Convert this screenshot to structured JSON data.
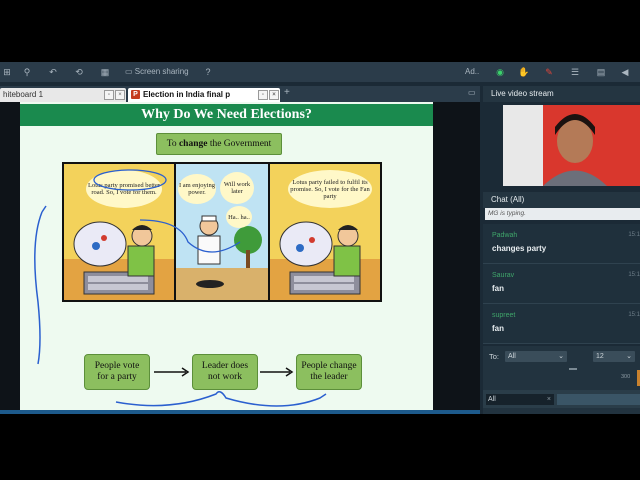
{
  "toolbar": {
    "screen_sharing_label": "Screen sharing",
    "user_initials": "Ad.."
  },
  "tabs": [
    {
      "label": "hiteboard 1"
    },
    {
      "label": "Election in India final p"
    }
  ],
  "slide": {
    "title": "Why Do We Need Elections?",
    "purpose_prefix": "To",
    "purpose_bold": "change",
    "purpose_suffix": "the Government",
    "panel1_bubble": "Lotus party promised better road. So, I vote for them.",
    "panel2_bubble1": "I am enjoying power.",
    "panel2_bubble2": "Will work later",
    "panel2_bubble3": "Ha.. ha..",
    "panel3_bubble": "Lotus party failed to fulfil its promise. So, I vote for the Fan party",
    "flow": [
      {
        "label": "People vote for a party"
      },
      {
        "label": "Leader does not work"
      },
      {
        "label": "People change the leader"
      }
    ]
  },
  "video": {
    "header": "Live video stream"
  },
  "chat": {
    "header": "Chat (All)",
    "typing_status": "MG is typing.",
    "messages": [
      {
        "name": "Padwah",
        "text": "changes party",
        "time": "15:1"
      },
      {
        "name": "Saurav",
        "text": "fan",
        "time": "15:1"
      },
      {
        "name": "supreet",
        "text": "fan",
        "time": "15:1"
      }
    ],
    "to_label": "To:",
    "to_value": "All",
    "font_size_value": "12",
    "char_count": "300",
    "recipient_tag": "All"
  },
  "colors": {
    "app_bg": "#1b2a36",
    "slide_title_bg": "#1a8a4e",
    "flow_box": "#8cbf5f",
    "chat_name": "#3fa56a",
    "video_bg": "#d9372d"
  }
}
